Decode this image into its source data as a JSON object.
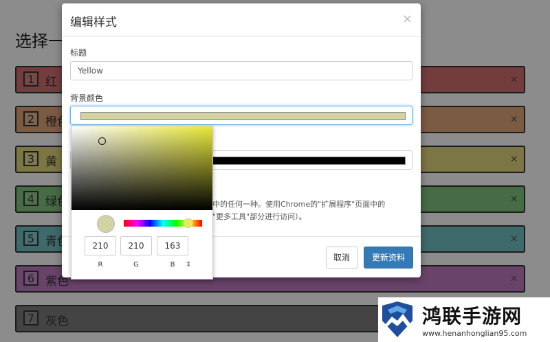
{
  "background": {
    "title": "选择一",
    "items": [
      {
        "num": "1",
        "label": "红",
        "color": "#d36f6f"
      },
      {
        "num": "2",
        "label": "橙色",
        "color": "#e2a77a"
      },
      {
        "num": "3",
        "label": "黄",
        "color": "#e2d67c"
      },
      {
        "num": "4",
        "label": "绿色",
        "color": "#80c47e"
      },
      {
        "num": "5",
        "label": "青色",
        "color": "#74c2c4"
      },
      {
        "num": "6",
        "label": "紫色",
        "color": "#c27bc4"
      },
      {
        "num": "7",
        "label": "灰色",
        "color": "#7c7c7c"
      }
    ],
    "close_glyph": "×"
  },
  "modal": {
    "title": "编辑样式",
    "close_glyph": "×",
    "title_label": "标题",
    "title_value": "Yellow",
    "bg_color_label": "背景颜色",
    "bg_color_swatch": "#d2d2a3",
    "text_color_swatch": "#000000",
    "help_line1": "式中的任何一种。使用Chrome的\"扩展程序\"页面中的",
    "help_line2": "的\"更多工具\"部分进行访问）。",
    "cancel_label": "取消",
    "submit_label": "更新资料",
    "primary_color": "#337ab7"
  },
  "picker": {
    "r": "210",
    "g": "210",
    "b": "163",
    "r_label": "R",
    "g_label": "G",
    "b_label": "B",
    "mode_toggle": "⇕",
    "preview_color": "#d2d2a3"
  },
  "watermark": {
    "title": "鸿联手游网",
    "url": "www.henanhonglian95.com"
  }
}
